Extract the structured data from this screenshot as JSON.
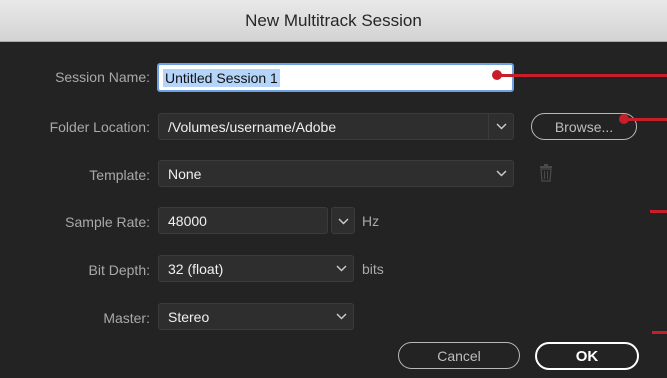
{
  "dialog": {
    "title": "New Multitrack Session"
  },
  "form": {
    "session_name": {
      "label": "Session Name:",
      "value": "Untitled Session 1"
    },
    "folder_location": {
      "label": "Folder Location:",
      "value": "/Volumes/username/Adobe"
    },
    "browse_label": "Browse...",
    "template": {
      "label": "Template:",
      "value": "None"
    },
    "sample_rate": {
      "label": "Sample Rate:",
      "value": "48000",
      "unit": "Hz"
    },
    "bit_depth": {
      "label": "Bit Depth:",
      "value": "32 (float)",
      "unit": "bits"
    },
    "master": {
      "label": "Master:",
      "value": "Stereo"
    }
  },
  "buttons": {
    "cancel_label": "Cancel",
    "ok_label": "OK"
  },
  "colors": {
    "background": "#232323",
    "title_bar": "#dedede",
    "annotation": "#c81e2a",
    "focus_ring": "#6ea0e4"
  },
  "icons": {
    "dropdown": "chevron-down-icon",
    "delete_template": "trash-icon"
  }
}
